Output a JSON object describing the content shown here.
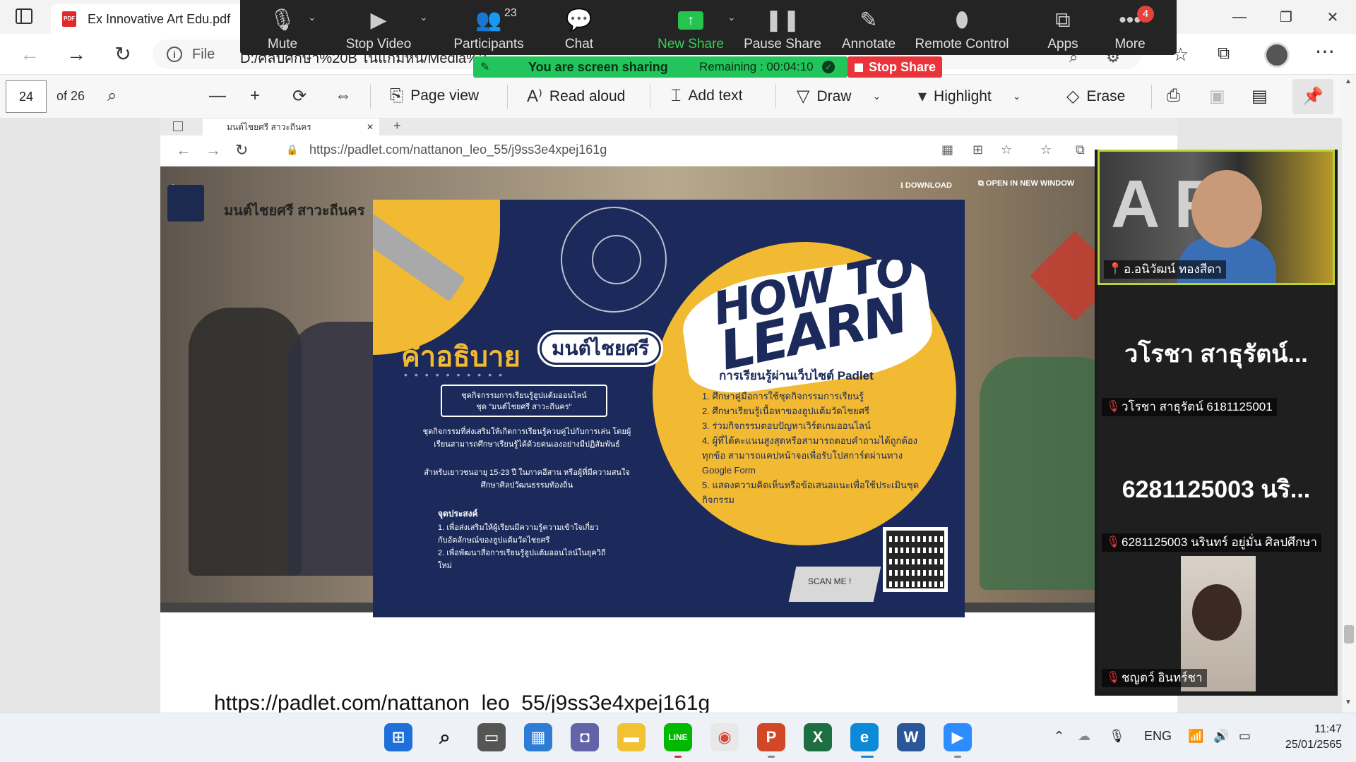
{
  "browser": {
    "tab_title": "Ex Innovative Art Edu.pdf",
    "address_file_label": "File",
    "address_path": "D:/ศิลปศึกษา%20B ไนแก้มหนี/Media%2"
  },
  "pdf_toolbar": {
    "page_number": "24",
    "page_total": "of 26",
    "page_view": "Page view",
    "read_aloud": "Read aloud",
    "add_text": "Add text",
    "draw": "Draw",
    "highlight": "Highlight",
    "erase": "Erase"
  },
  "zoom_toolbar": {
    "mute": "Mute",
    "stop_video": "Stop Video",
    "participants": "Participants",
    "participants_count": "23",
    "chat": "Chat",
    "new_share": "New Share",
    "pause_share": "Pause Share",
    "annotate": "Annotate",
    "remote_control": "Remote Control",
    "apps": "Apps",
    "more": "More",
    "more_badge": "4"
  },
  "share_status": {
    "message": "You are screen sharing",
    "remaining": "Remaining : 00:04:10",
    "stop_label": "Stop Share"
  },
  "inner_browser": {
    "tab_title": "มนต์ไชยศรี สาวะถีนคร",
    "url": "https://padlet.com/nattanon_leo_55/j9ss3e4xpej161g",
    "download_label": "DOWNLOAD",
    "open_new_label": "OPEN IN NEW WINDOW",
    "padlet_title": "มนต์ไชยศรี สาวะถีนคร"
  },
  "poster": {
    "how_to": "HOW TO",
    "learn": "LEARN",
    "subtitle": "การเรียนรู้ผ่านเว็บไซต์ Padlet",
    "steps": [
      "1. ศึกษาคู่มือการใช้ชุดกิจกรรมการเรียนรู้",
      "2. ศึกษาเรียนรู้เนื้อหาของฮูปแต้มวัดไชยศรี",
      "3. ร่วมกิจกรรมตอบปัญหาเวิร์ดเกมออนไลน์",
      "4. ผู้ที่ได้คะแนนสูงสุดหรือสามารถตอบคำถามได้ถูกต้องทุกข้อ สามารถแคปหน้าจอเพื่อรับโปสการ์ดผ่านทาง Google Form",
      "5. แสดงความคิดเห็นหรือข้อเสนอแนะเพื่อใช้ประเมินชุดกิจกรรม"
    ],
    "kham": "คำอธิบาย",
    "mon": "มนต์ไชยศรี",
    "box_line1": "ชุดกิจกรรมการเรียนรู้ฮูปแต้มออนไลน์",
    "box_line2": "ชุด \"มนต์ไชยศรี สาวะถีนคร\"",
    "desc": "ชุดกิจกรรมที่ส่งเสริมให้เกิดการเรียนรู้ควบคู่ไปกับการเล่น โดยผู้เรียนสามารถศึกษาเรียนรู้ได้ด้วยตนเองอย่างมีปฏิสัมพันธ์",
    "desc2": "สำหรับเยาวชนอายุ 15-23 ปี ในภาคอีสาน หรือผู้ที่มีความสนใจศึกษาศิลปวัฒนธรรมท้องถิ่น",
    "goal_title": "จุดประสงค์",
    "goals": [
      "1. เพื่อส่งเสริมให้ผู้เรียนมีความรู้ความเข้าใจเกี่ยวกับอัตลักษณ์ของฮูปแต้มวัดไชยศรี",
      "2. เพื่อพัฒนาสื่อการเรียนรู้ฮูปแต้มออนไลน์ในยุควิถีใหม่"
    ],
    "scan": "SCAN ME !"
  },
  "page_link": "https://padlet.com/nattanon_leo_55/j9ss3e4xpej161g",
  "gallery": {
    "tile1_name": "อ.อนิวัฒน์ ทองสีดา",
    "tile2_big": "วโรชา สาธุรัตน์...",
    "tile2_name": "วโรชา สาธุรัตน์ 6181125001",
    "tile3_big": "6281125003 นริ...",
    "tile3_name": "6281125003 นรินทร์ อยู่มั่น ศิลปศึกษา",
    "tile4_name": "ชญตว์ อินทร์ชา"
  },
  "taskbar": {
    "lang": "ENG",
    "time": "11:47",
    "date": "25/01/2565"
  },
  "colors": {
    "zoom_green": "#22c45c",
    "stop_red": "#e8343a",
    "poster_navy": "#1b2a5a",
    "poster_yellow": "#f2b932",
    "active_speaker": "#b7d432"
  }
}
